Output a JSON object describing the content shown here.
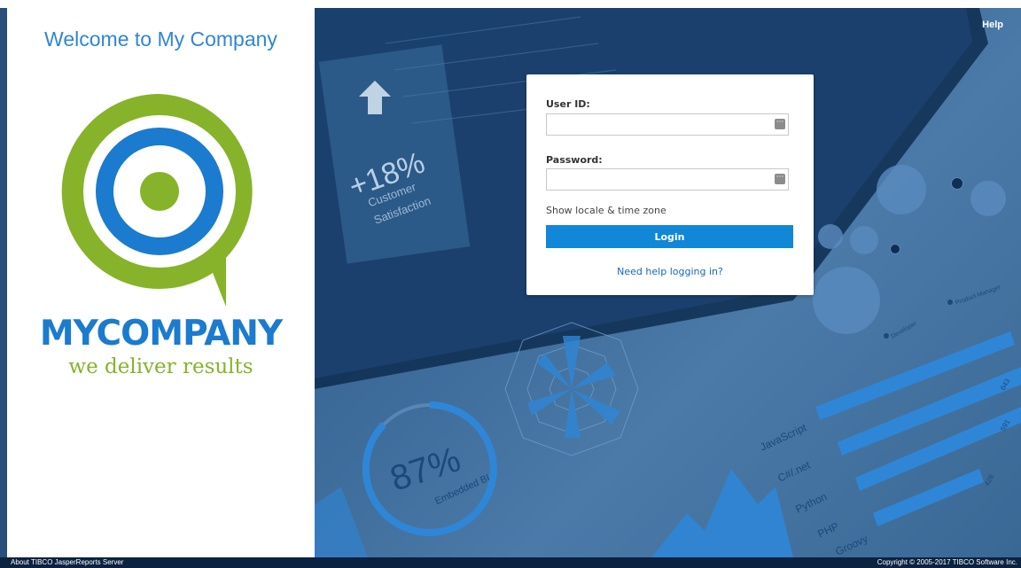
{
  "panel": {
    "welcome": "Welcome to My Company",
    "brand": "MYCOMPANY",
    "tagline": "we deliver results"
  },
  "header": {
    "help_label": "Help"
  },
  "login": {
    "user_label": "User ID:",
    "user_value": "",
    "password_label": "Password:",
    "password_value": "",
    "locale_link": "Show locale & time zone",
    "login_button": "Login",
    "need_help": "Need help logging in?"
  },
  "background": {
    "kpi1": "+18%",
    "kpi1_caption_1": "Customer",
    "kpi1_caption_2": "Satisfaction",
    "kpi2": "87%",
    "kpi2_caption": "Embedded BI",
    "languages": [
      "JavaScript",
      "C#/.net",
      "Python",
      "PHP",
      "Groovy"
    ],
    "language_values": [
      "643",
      "591",
      "428"
    ],
    "legend_1": "Developer",
    "legend_2": "Product Manager"
  },
  "footer": {
    "about": "About TIBCO JasperReports Server",
    "copyright": "Copyright © 2005-2017 TIBCO Software Inc."
  },
  "colors": {
    "accent_blue": "#1187d7",
    "logo_green": "#86b32a",
    "logo_blue": "#1b7bcf"
  }
}
